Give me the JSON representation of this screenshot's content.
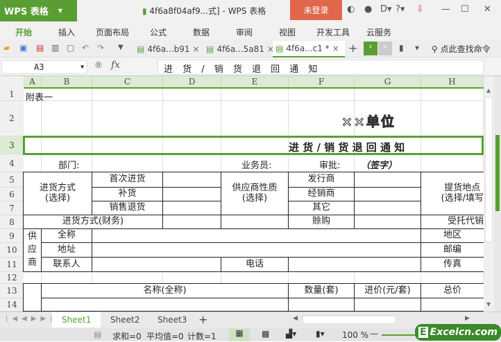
{
  "app": {
    "logo": "WPS 表格",
    "doc_title": "4f6a8f04af9...式] - WPS 表格",
    "login": "未登录"
  },
  "menu": [
    "开始",
    "插入",
    "页面布局",
    "公式",
    "数据",
    "审阅",
    "视图",
    "开发工具",
    "云服务"
  ],
  "doc_tabs": [
    {
      "label": "4f6a...b91",
      "active": false
    },
    {
      "label": "4f6a...5a81",
      "active": false
    },
    {
      "label": "4f6a...c1 *",
      "active": true
    }
  ],
  "search_label": "点此查找命令",
  "formula_bar": {
    "name_box": "A3",
    "fx": "fx",
    "value": "进 货 / 销 货 退 回     通 知"
  },
  "columns": [
    "A",
    "B",
    "C",
    "D",
    "E",
    "F",
    "G",
    "H"
  ],
  "rows": [
    "1",
    "2",
    "3",
    "4",
    "5",
    "6",
    "7",
    "8",
    "9",
    "10",
    "11",
    "12",
    "13",
    "14"
  ],
  "cells": {
    "a1": "附表一",
    "title": "××单位",
    "subtitle": "进 货 / 销 货 退 回    通 知",
    "dept": "部门:",
    "clerk": "业务员:",
    "approve": "审批:",
    "sign": "（签字）",
    "purchase_mode": "进货方式\n(选择)",
    "first": "首次进货",
    "restock": "补货",
    "return": "销售退货",
    "supplier_type": "供应商性质\n(选择)",
    "publisher": "发行商",
    "dealer": "经销商",
    "other": "其它",
    "pickup": "提货地点\n(选择/填写",
    "finance_mode": "进货方式(财务)",
    "credit": "赊购",
    "consign": "受托代销",
    "supplier": "供\n应\n商",
    "fullname": "全称",
    "region": "地区",
    "address": "地址",
    "postcode": "邮编",
    "contact": "联系人",
    "phone": "电话",
    "fax": "传真",
    "name_full": "名称(全称)",
    "qty": "数量(套)",
    "price": "进价(元/套)",
    "total": "总价"
  },
  "sheets": [
    {
      "label": "Sheet1",
      "active": true
    },
    {
      "label": "Sheet2",
      "active": false
    },
    {
      "label": "Sheet3",
      "active": false
    }
  ],
  "status": {
    "sum": "求和=0",
    "avg": "平均值=0",
    "count": "计数=1",
    "zoom": "100 %"
  },
  "watermark": "Excelcn.com",
  "colors": {
    "accent": "#5a9e33",
    "login": "#e0674b"
  }
}
